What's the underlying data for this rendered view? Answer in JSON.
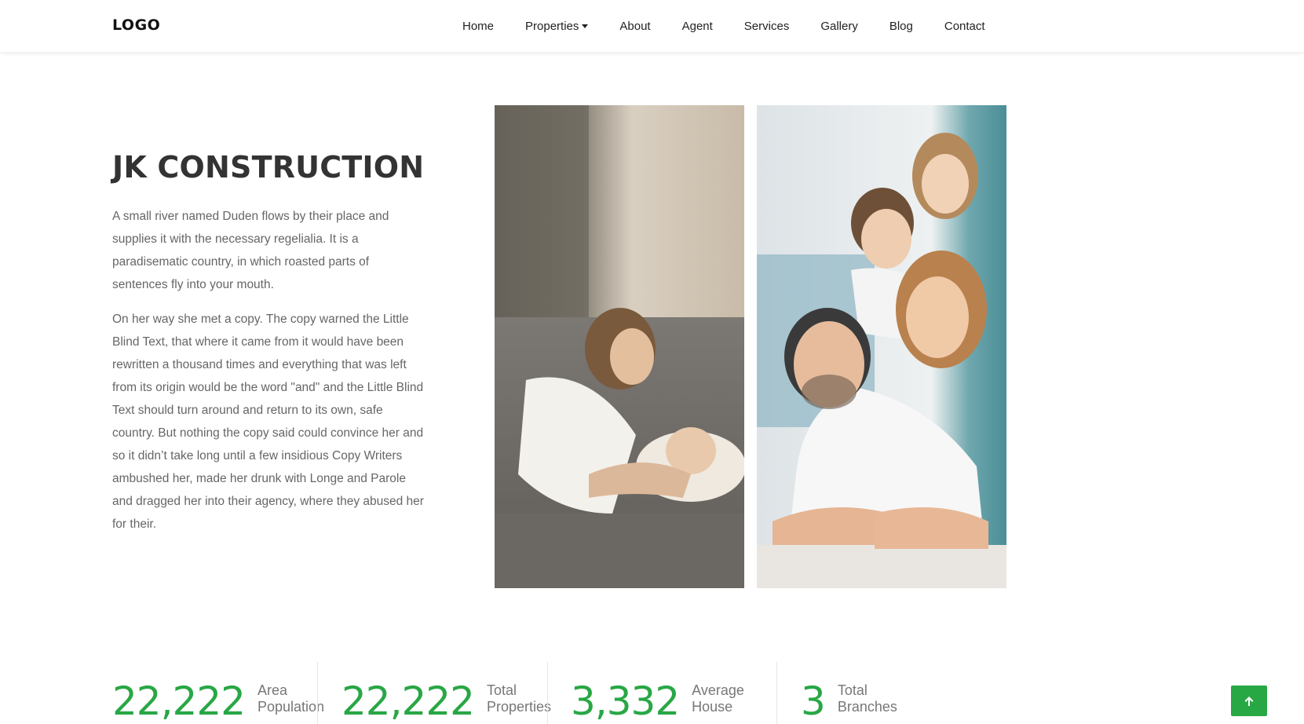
{
  "nav": {
    "logo": "LOGO",
    "items": [
      {
        "label": "Home"
      },
      {
        "label": "Properties",
        "has_dropdown": true
      },
      {
        "label": "About"
      },
      {
        "label": "Agent"
      },
      {
        "label": "Services"
      },
      {
        "label": "Gallery"
      },
      {
        "label": "Blog"
      },
      {
        "label": "Contact"
      }
    ]
  },
  "about": {
    "title": "JK CONSTRUCTION",
    "paragraphs": [
      "A small river named Duden flows by their place and supplies it with the necessary regelialia. It is a paradisematic country, in which roasted parts of sentences fly into your mouth.",
      "On her way she met a copy. The copy warned the Little Blind Text, that where it came from it would have been rewritten a thousand times and everything that was left from its origin would be the word \"and\" and the Little Blind Text should turn around and return to its own, safe country. But nothing the copy said could convince her and so it didn’t take long until a few insidious Copy Writers ambushed her, made her drunk with Longe and Parole and dragged her into their agency, where they abused her for their."
    ]
  },
  "stats": [
    {
      "value": "22,222",
      "label": "Area Population"
    },
    {
      "value": "22,222",
      "label": "Total Properties"
    },
    {
      "value": "3,332",
      "label": "Average House"
    },
    {
      "value": "3",
      "label": "Total Branches"
    }
  ],
  "colors": {
    "accent": "#28a745",
    "text_dark": "#333333",
    "text_muted": "#666666"
  },
  "icons": {
    "dropdown": "caret-down-icon",
    "back_to_top": "arrow-up-icon"
  }
}
